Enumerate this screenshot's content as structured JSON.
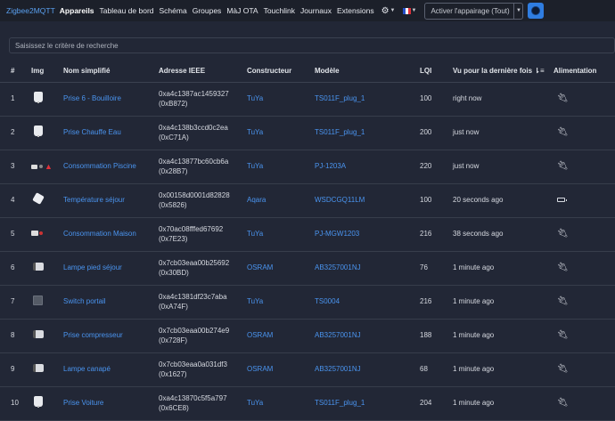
{
  "nav": {
    "brand": "Zigbee2MQTT",
    "items": [
      "Appareils",
      "Tableau de bord",
      "Schéma",
      "Groupes",
      "MàJ OTA",
      "Touchlink",
      "Journaux",
      "Extensions"
    ],
    "permit_join_label": "Activer l'appairage (Tout)"
  },
  "search": {
    "placeholder": "Saisissez le critère de recherche"
  },
  "table": {
    "headers": [
      "#",
      "Img",
      "Nom simplifié",
      "Adresse IEEE",
      "Constructeur",
      "Modèle",
      "LQI",
      "Vu pour la dernière fois ⇂≡",
      "Alimentation"
    ],
    "rows": [
      {
        "num": "1",
        "name": "Prise 6 - Bouilloire",
        "ieee": "0xa4c1387ac1459327",
        "nwk": "(0xB872)",
        "vendor": "TuYa",
        "model": "TS011F_plug_1",
        "lqi": "100",
        "seen": "right now",
        "power": "mains",
        "img": "plug"
      },
      {
        "num": "2",
        "name": "Prise Chauffe Eau",
        "ieee": "0xa4c138b3ccd0c2ea",
        "nwk": "(0xC71A)",
        "vendor": "TuYa",
        "model": "TS011F_plug_1",
        "lqi": "200",
        "seen": "just now",
        "power": "mains",
        "img": "plug"
      },
      {
        "num": "3",
        "name": "Consommation Piscine",
        "ieee": "0xa4c13877bc60cb6a",
        "nwk": "(0x28B7)",
        "vendor": "TuYa",
        "model": "PJ-1203A",
        "lqi": "220",
        "seen": "just now",
        "power": "mains",
        "img": "clamp-warn"
      },
      {
        "num": "4",
        "name": "Température séjour",
        "ieee": "0x00158d0001d82828",
        "nwk": "(0x5826)",
        "vendor": "Aqara",
        "model": "WSDCGQ11LM",
        "lqi": "100",
        "seen": "20 seconds ago",
        "power": "battery",
        "img": "sensor"
      },
      {
        "num": "5",
        "name": "Consommation Maison",
        "ieee": "0x70ac08fffed67692",
        "nwk": "(0x7E23)",
        "vendor": "TuYa",
        "model": "PJ-MGW1203",
        "lqi": "216",
        "seen": "38 seconds ago",
        "power": "mains",
        "img": "clamp"
      },
      {
        "num": "6",
        "name": "Lampe pied séjour",
        "ieee": "0x7cb03eaa00b25692",
        "nwk": "(0x30BD)",
        "vendor": "OSRAM",
        "model": "AB3257001NJ",
        "lqi": "76",
        "seen": "1 minute ago",
        "power": "mains",
        "img": "osram"
      },
      {
        "num": "7",
        "name": "Switch portail",
        "ieee": "0xa4c1381df23c7aba",
        "nwk": "(0xA74F)",
        "vendor": "TuYa",
        "model": "TS0004",
        "lqi": "216",
        "seen": "1 minute ago",
        "power": "mains",
        "img": "switch"
      },
      {
        "num": "8",
        "name": "Prise compresseur",
        "ieee": "0x7cb03eaa00b274e9",
        "nwk": "(0x728F)",
        "vendor": "OSRAM",
        "model": "AB3257001NJ",
        "lqi": "188",
        "seen": "1 minute ago",
        "power": "mains",
        "img": "osram"
      },
      {
        "num": "9",
        "name": "Lampe canapé",
        "ieee": "0x7cb03eaa0a031df3",
        "nwk": "(0x1627)",
        "vendor": "OSRAM",
        "model": "AB3257001NJ",
        "lqi": "68",
        "seen": "1 minute ago",
        "power": "mains",
        "img": "osram"
      },
      {
        "num": "10",
        "name": "Prise Voiture",
        "ieee": "0xa4c13870c5f5a797",
        "nwk": "(0x6CE8)",
        "vendor": "TuYa",
        "model": "TS011F_plug_1",
        "lqi": "204",
        "seen": "1 minute ago",
        "power": "mains",
        "img": "plug"
      }
    ]
  },
  "colors": {
    "accent": "#2f7de1",
    "link": "#4a94ef",
    "background": "#222736",
    "navbar": "#1c202a"
  }
}
